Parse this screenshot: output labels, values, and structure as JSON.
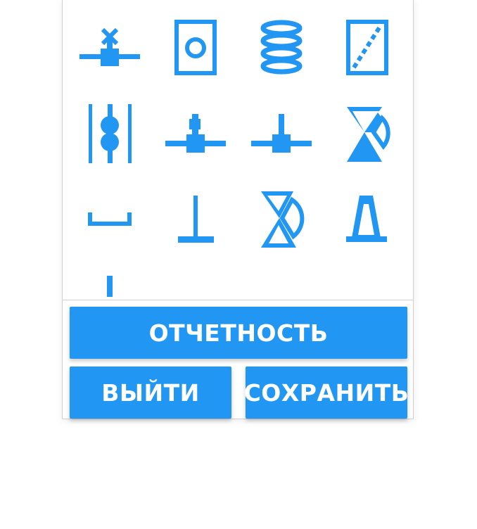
{
  "colors": {
    "accent": "#2196F3",
    "border": "#cfcfcf",
    "background": "#ffffff"
  },
  "palette": {
    "icons": [
      "valve-with-actuator-icon",
      "orifice-plate-icon",
      "coil-spring-icon",
      "rupture-disc-icon",
      "double-ball-check-icon",
      "manual-valve-icon",
      "tee-tap-icon",
      "angle-valve-icon",
      "cap-icon",
      "t-support-icon",
      "angle-check-valve-icon",
      "cone-reducer-icon",
      "partial-symbol-icon"
    ]
  },
  "actions": {
    "report_label": "ОТЧЕТНОСТЬ",
    "exit_label": "ВЫЙТИ",
    "save_label": "СОХРАНИТЬ"
  }
}
